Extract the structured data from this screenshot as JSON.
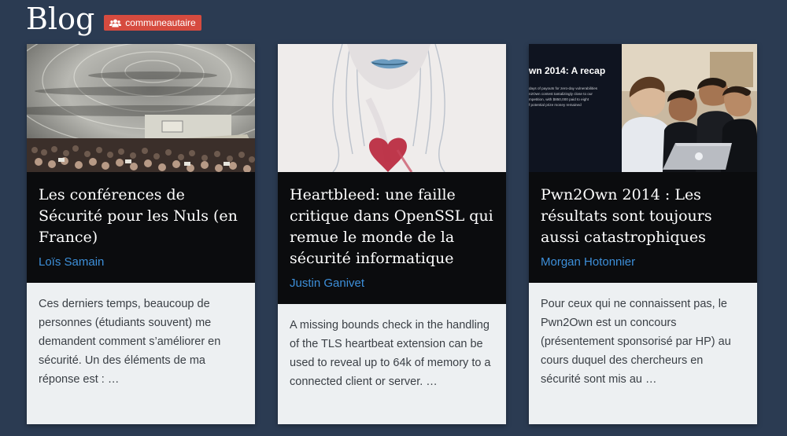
{
  "header": {
    "title": "Blog",
    "category_badge": "communeautaire"
  },
  "cards": [
    {
      "title": "Les conférences de Sécurité pour les Nuls (en France)",
      "author": "Loïs Samain",
      "excerpt": "Ces derniers temps, beaucoup de personnes (étudiants souvent) me demandent comment s’améliorer en sécurité. Un des éléments de ma réponse est : …"
    },
    {
      "title": "Heartbleed: une faille critique dans OpenSSL qui remue le monde de la sécurité informatique",
      "author": "Justin Ganivet",
      "excerpt": "A missing bounds check in the handling of the TLS heartbeat extension can be used to reveal up to 64k of memory to a connected client or server. …"
    },
    {
      "title": "Pwn2Own 2014 : Les résultats sont toujours aussi catastrophiques",
      "author": "Morgan Hotonnier",
      "excerpt": "Pour ceux qui ne connaissent pas, le Pwn2Own est un concours (présentement sponsorisé par HP) au cours duquel des chercheurs en sécurité sont mis au …",
      "thumb_slide": {
        "heading": "wn 2014: A recap",
        "line1": "days of payouts for zero-day vulnerabilities",
        "line2": "n2Own contest tantalizingly close to our",
        "line3": "mpetition, with $850,000 paid to eight",
        "line4": "f potential prize money remained"
      }
    }
  ],
  "colors": {
    "background": "#2b3b52",
    "badge": "#d64b3f",
    "card_head": "#0b0c0e",
    "card_body": "#edf0f2",
    "author_link": "#3d8fd9"
  },
  "icons": {
    "badge_icon": "users-icon"
  }
}
